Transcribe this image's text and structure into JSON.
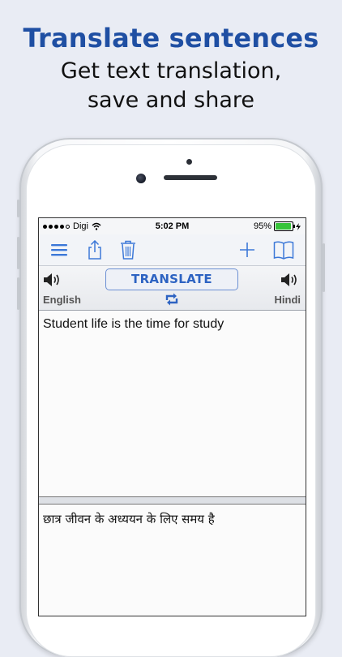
{
  "promo": {
    "title": "Translate sentences",
    "subtitle_line1": "Get text translation,",
    "subtitle_line2": "save and share"
  },
  "status_bar": {
    "carrier": "Digi",
    "time": "5:02 PM",
    "battery": "95%",
    "battery_level": 0.95
  },
  "toolbar": {
    "icons": [
      "menu-icon",
      "share-icon",
      "trash-icon",
      "add-icon",
      "dictionary-book-icon"
    ]
  },
  "language_bar": {
    "translate_label": "TRANSLATE",
    "source_language": "English",
    "target_language": "Hindi"
  },
  "source_text": "Student life is the time for study",
  "translated_text": "छात्र जीवन के अध्ययन के लिए समय है",
  "colors": {
    "accent": "#2d63c2",
    "title_blue": "#1f4fa3",
    "battery_green": "#37c43a"
  }
}
